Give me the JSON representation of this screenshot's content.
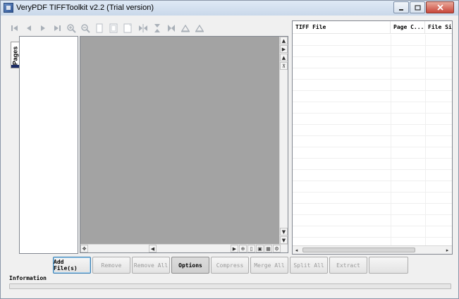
{
  "window": {
    "title": "VeryPDF TIFFToolkit v2.2 (Trial version)",
    "controls": [
      "minimize",
      "maximize",
      "close"
    ]
  },
  "toolbar": {
    "icons": [
      "first-page-icon",
      "prev-page-icon",
      "next-page-icon",
      "last-page-icon",
      "zoom-in-icon",
      "zoom-out-icon",
      "actual-size-icon",
      "fit-page-icon",
      "fit-width-icon",
      "flip-horizontal-icon",
      "flip-vertical-icon",
      "rotate-icon",
      "rotate-left-icon",
      "rotate-right-icon"
    ]
  },
  "pages_tab": {
    "label": "Pages"
  },
  "filelist": {
    "columns": [
      "TIFF File",
      "Page C...",
      "File Siz"
    ]
  },
  "buttons": {
    "add_files": "Add File(s)",
    "remove": "Remove",
    "remove_all": "Remove All",
    "options": "Options",
    "compress": "Compress",
    "merge_all": "Merge All",
    "split_all": "Split All",
    "extract": "Extract"
  },
  "info": {
    "label": "Information"
  }
}
